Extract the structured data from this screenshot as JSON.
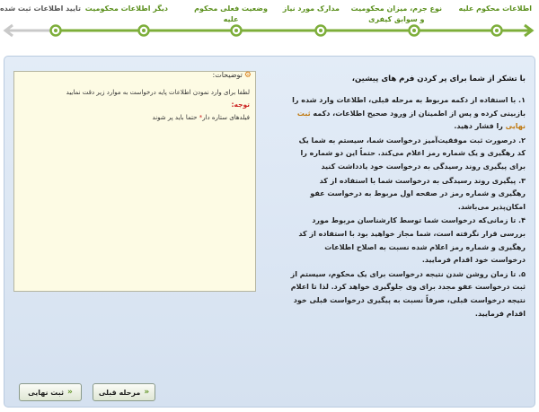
{
  "wizard": {
    "steps": [
      {
        "label": "اطلاعات محکوم علیه"
      },
      {
        "label": "نوع جرم، میزان محکومیت\nو سوابق کیفری"
      },
      {
        "label": "مدارک مورد نیاز"
      },
      {
        "label": "وضعیت فعلی محکوم\nعلیه"
      },
      {
        "label": "دیگر اطلاعات محکومیت"
      },
      {
        "label": "تایید اطلاعات ثبت شده"
      }
    ],
    "colors": {
      "done": "#7dae3a",
      "pending": "#c9c9c9",
      "node": "#ffffff"
    }
  },
  "intro": {
    "title": "با تشکر از شما برای پر کردن فرم های پیشین،",
    "items": [
      {
        "before": "۱. با استفاده از دکمه مربوط به مرحله قبلی، اطلاعات وارد شده را بازبینی کرده و پس از اطمینان از ورود صحیح اطلاعات، دکمه ",
        "highlight": "ثبت نهایی",
        "after": " را فشار دهید."
      },
      {
        "before": "۲. درصورت ثبت موفقیت‌آمیز درخواست شما، سیستم به شما یک کد رهگیری و یک شماره رمز اعلام می‌کند. حتماً این دو شماره را برای پیگیری روند رسیدگی به درخواست خود یادداشت کنید",
        "highlight": "",
        "after": ""
      },
      {
        "before": "۳. پیگیری روند رسیدگی به درخواست شما با استفاده از کد رهگیری و شماره رمز در صفحه اول مربوط به درخواست عفو امکان‌پذیر می‌باشد.",
        "highlight": "",
        "after": ""
      },
      {
        "before": "۴. تا زمانی‌که درخواست شما توسط کارشناسان مربوط مورد بررسی قرار نگرفته است، شما مجاز خواهید بود با استفاده از کد رهگیری و شماره رمز اعلام شده نسبت به اصلاح اطلاعات درخواست خود اقدام فرمایید.",
        "highlight": "",
        "after": ""
      },
      {
        "before": "۵. تا زمان روشن شدن نتیجه درخواست برای یک محکوم، سیستم از ثبت درخواست عفو مجدد برای وی جلوگیری خواهد کرد. لذا تا اعلام نتیجه درخواست قبلی، صرفاً نسبت به پیگیری درخواست قبلی خود اقدام فرمایید.",
        "highlight": "",
        "after": ""
      }
    ]
  },
  "notes": {
    "header": "توضیحات:",
    "line1": "لطفا برای وارد نمودن اطلاعات پایه درخواست به موارد زیر دقت نمایید",
    "attention": "توجه:",
    "line2_before": "فیلدهای ستاره دار",
    "star": "*",
    "line2_after": "حتما باید پر شوند"
  },
  "buttons": {
    "previous": "مرحله قبلی",
    "final": "ثبت نهایی"
  }
}
